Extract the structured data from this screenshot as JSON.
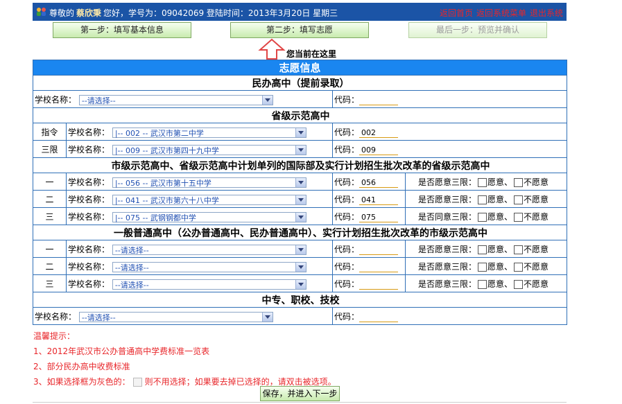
{
  "header": {
    "greeting_prefix": "尊敬的",
    "user_name": "蔡欣秉",
    "greeting_suffix": "您好，学号为：09042069  登陆时间：2013年3月20日  星期三",
    "links": [
      "返回首页",
      "返回系统菜单",
      "退出系统"
    ]
  },
  "steps": [
    {
      "label": "第一步：填写基本信息",
      "state": "done"
    },
    {
      "label": "第二步：填写志愿",
      "state": "current"
    },
    {
      "label": "最后一步：预览并确认",
      "state": "disabled"
    }
  ],
  "current_indicator": "您当前在这里",
  "form": {
    "title": "志愿信息",
    "school_label": "学校名称：",
    "code_label": "代码：",
    "willing_question": "是否愿意三限：",
    "willing_question_alt": "是否同意三限：",
    "willing_yes": "愿意、",
    "willing_no": "不愿意",
    "placeholder": "--请选择--",
    "sections": {
      "private": {
        "heading": "民办高中（提前录取）",
        "rows": [
          {
            "school": "--请选择--",
            "code": ""
          }
        ]
      },
      "provincial": {
        "heading": "省级示范高中",
        "rows": [
          {
            "tag": "指令",
            "school": "|-- 002 -- 武汉市第二中学",
            "code": "002"
          },
          {
            "tag": "三限",
            "school": "|-- 009 -- 武汉市第四十九中学",
            "code": "009"
          }
        ]
      },
      "city": {
        "heading": "市级示范高中、省级示范高中计划单列的国际部及实行计划招生批次改革的省级示范高中",
        "rows": [
          {
            "tag": "一",
            "school": "|-- 056 -- 武汉市第十五中学",
            "code": "056"
          },
          {
            "tag": "二",
            "school": "|-- 041 -- 武汉市第六十八中学",
            "code": "041"
          },
          {
            "tag": "三",
            "school": "|-- 075 -- 武钢钢都中学",
            "code": "075"
          }
        ]
      },
      "general": {
        "heading": "一般普通高中（公办普通高中、民办普通高中）、实行计划招生批次改革的市级示范高中",
        "rows": [
          {
            "tag": "一",
            "school": "--请选择--",
            "code": ""
          },
          {
            "tag": "二",
            "school": "--请选择--",
            "code": ""
          },
          {
            "tag": "三",
            "school": "--请选择--",
            "code": ""
          }
        ]
      },
      "vocational": {
        "heading": "中专、职校、技校",
        "rows": [
          {
            "school": "--请选择--",
            "code": ""
          }
        ]
      }
    }
  },
  "tips": {
    "title": "温馨提示：",
    "item1": "1、2012年武汉市公办普通高中学费标准一览表",
    "item2": "2、部分民办高中收费标准",
    "item3a": "3、如果选择框为灰色的：",
    "item3b": "则不用选择；如果要去掉已选择的，请双击被选项。"
  },
  "save_button": "保存，并进入下一步",
  "colors": {
    "header_bg": "#1b54a6",
    "title_bg": "#1a86f0",
    "link_red": "#e8262a",
    "border_blue": "#2f6fb7"
  }
}
